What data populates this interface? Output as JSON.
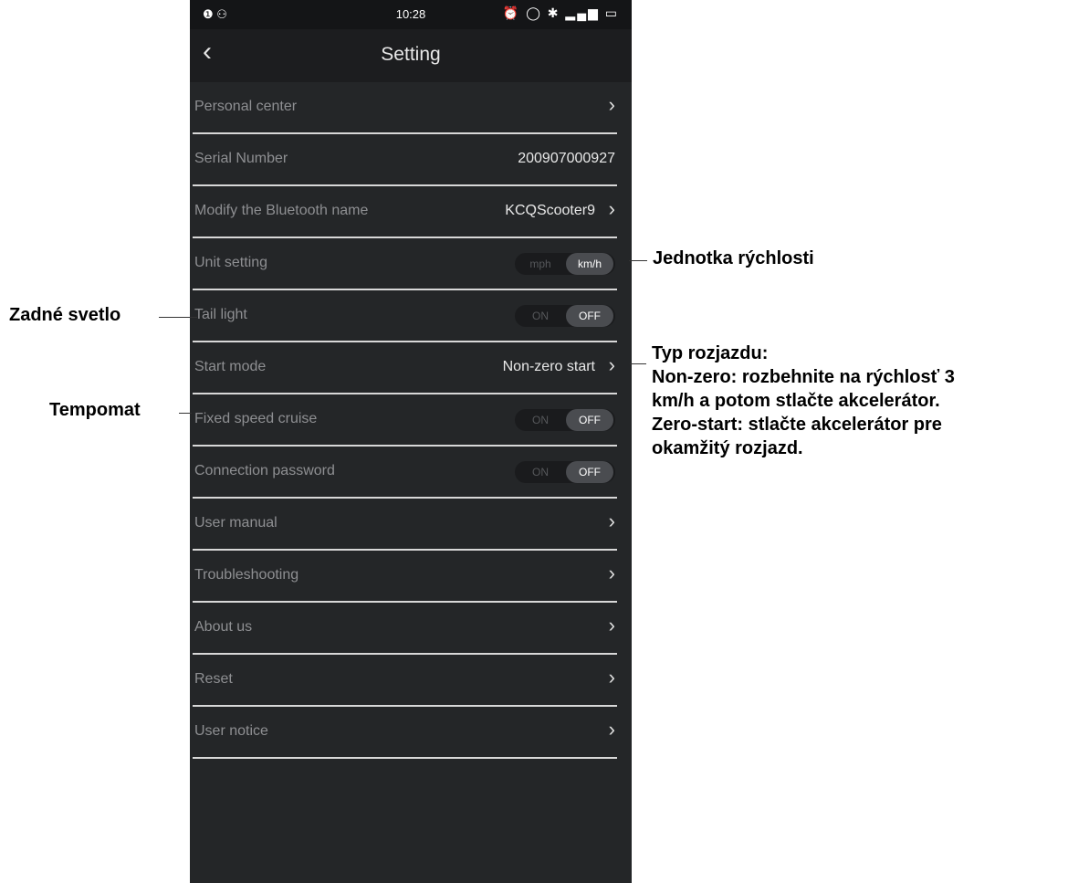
{
  "status_bar": {
    "left_icons": "❶ ⚇",
    "time": "10:28",
    "right_icons": "⏰ ◯ ✱ ▂▄▆ ▭"
  },
  "header": {
    "back_icon": "‹",
    "title": "Setting"
  },
  "settings": [
    {
      "label": "Personal center",
      "value": "",
      "control": "arrow"
    },
    {
      "label": "Serial Number",
      "value": "200907000927",
      "control": "none"
    },
    {
      "label": "Modify the Bluetooth name",
      "value": "KCQScooter9",
      "control": "arrow"
    },
    {
      "label": "Unit setting",
      "control": "toggle",
      "options": [
        "mph",
        "km/h"
      ],
      "selected": "km/h"
    },
    {
      "label": "Tail light",
      "control": "toggle",
      "options": [
        "ON",
        "OFF"
      ],
      "selected": "OFF"
    },
    {
      "label": "Start mode",
      "value": "Non-zero start",
      "control": "arrow"
    },
    {
      "label": "Fixed speed cruise",
      "control": "toggle",
      "options": [
        "ON",
        "OFF"
      ],
      "selected": "OFF"
    },
    {
      "label": "Connection password",
      "control": "toggle",
      "options": [
        "ON",
        "OFF"
      ],
      "selected": "OFF"
    },
    {
      "label": "User manual",
      "control": "arrow"
    },
    {
      "label": "Troubleshooting",
      "control": "arrow"
    },
    {
      "label": "About us",
      "control": "arrow"
    },
    {
      "label": "Reset",
      "control": "arrow"
    },
    {
      "label": "User notice",
      "control": "arrow"
    }
  ],
  "annotations": {
    "unit": "Jednotka rýchlosti",
    "tail_light": "Zadné svetlo",
    "cruise": "Tempomat",
    "start_mode": [
      "Typ rozjazdu:",
      "Non-zero: rozbehnite na rýchlosť 3",
      "km/h a potom stlačte akcelerátor.",
      "Zero-start: stlačte akcelerátor pre",
      "okamžitý rozjazd."
    ]
  },
  "colors": {
    "screen_bg": "#242628",
    "status_bar_bg": "#141517",
    "divider": "#d8d8d8",
    "label_text": "#8e8f92",
    "value_text": "#e8e8e8",
    "toggle_active": "#4a4c50"
  }
}
